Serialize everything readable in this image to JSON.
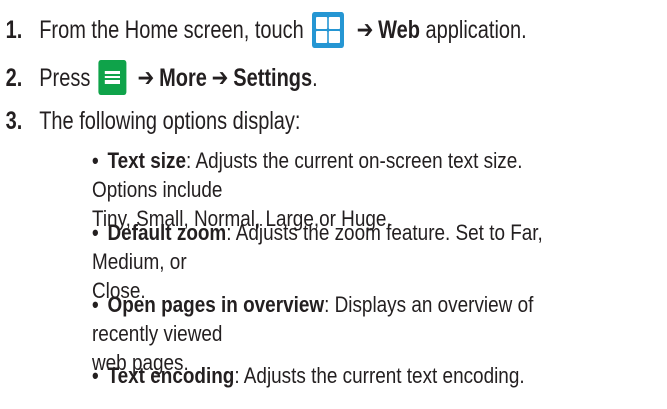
{
  "steps": [
    {
      "number": "1.",
      "text_before": "From the Home screen, touch",
      "icon": "apps-grid-icon",
      "arrow": "➔",
      "bold": "Web",
      "text_after": " application."
    },
    {
      "number": "2.",
      "text_before": "Press",
      "icon": "menu-key-icon",
      "arrow1": "➔",
      "bold1": "More",
      "arrow2": "➔",
      "bold2": "Settings",
      "text_after": "."
    },
    {
      "number": "3.",
      "text": "The following options display:"
    }
  ],
  "options": [
    {
      "title": "Text size",
      "desc_line1": ": Adjusts the current on-screen text size. Options include",
      "desc_line2": "Tiny, Small, Normal, Large,or Huge."
    },
    {
      "title": "Default zoom",
      "desc_line1": ": Adjusts the zoom feature. Set to Far, Medium, or",
      "desc_line2": "Close."
    },
    {
      "title": "Open pages in overview",
      "desc_line1": ": Displays an overview of recently viewed",
      "desc_line2": "web pages."
    },
    {
      "title": "Text encoding",
      "desc_line1": ": Adjusts the current text encoding.",
      "desc_line2": ""
    }
  ],
  "bullet_char": "•",
  "colors": {
    "apps_icon": "#2596d3",
    "menu_icon": "#0fa34a",
    "text": "#231f20"
  }
}
